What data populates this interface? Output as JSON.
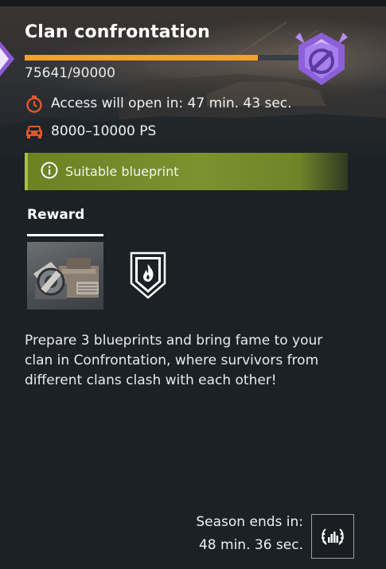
{
  "header": {
    "title": "Clan confrontation",
    "progress_current": 75641,
    "progress_max": 90000,
    "progress_text": "75641/90000",
    "emblem_icon": "clan-rank-emblem-icon"
  },
  "info": {
    "access_text": "Access will open in: 47 min. 43 sec.",
    "access_icon": "stopwatch-icon",
    "power_text": "8000–10000 PS",
    "power_icon": "vehicle-icon"
  },
  "banner": {
    "text": "Suitable blueprint",
    "icon": "info-icon"
  },
  "reward": {
    "tab_label": "Reward",
    "items": [
      {
        "icon": "blueprint-crate-icon"
      },
      {
        "icon": "fire-shield-badge-icon"
      }
    ]
  },
  "description": "Prepare 3 blueprints and bring fame to your clan in Confrontation, where survivors from different clans clash with each other!",
  "season": {
    "label": "Season ends in:",
    "time": "48 min. 36 sec.",
    "icon": "laurel-rating-icon"
  },
  "colors": {
    "accent_orange": "#f2a12a",
    "banner_green": "#7a9230",
    "emblem_purple": "#9b6fe0",
    "background": "#1c2126"
  }
}
